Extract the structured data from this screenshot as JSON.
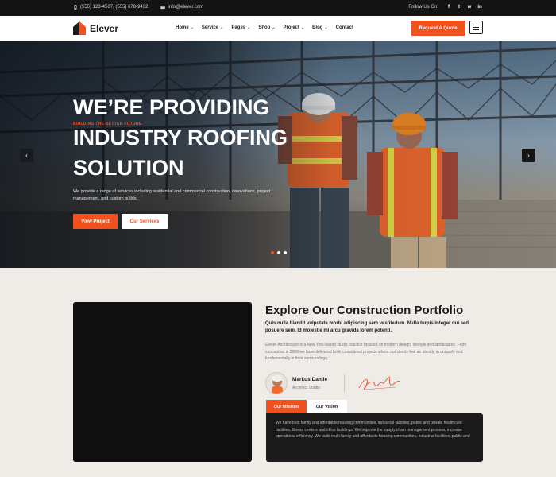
{
  "topbar": {
    "phone": "(555) 123-4567, (555) 678-9432",
    "email": "info@elever.com",
    "follow_label": "Follow Us On:",
    "social": [
      {
        "icon": "facebook-icon",
        "glyph": "f"
      },
      {
        "icon": "twitter-icon",
        "glyph": "t"
      },
      {
        "icon": "whatsapp-icon",
        "glyph": "w"
      },
      {
        "icon": "linkedin-icon",
        "glyph": "in"
      }
    ]
  },
  "header": {
    "brand": "Elever",
    "nav": [
      {
        "label": "Home",
        "has_dropdown": true
      },
      {
        "label": "Service",
        "has_dropdown": true
      },
      {
        "label": "Pages",
        "has_dropdown": true
      },
      {
        "label": "Shop",
        "has_dropdown": true
      },
      {
        "label": "Project",
        "has_dropdown": true
      },
      {
        "label": "Blog",
        "has_dropdown": true
      },
      {
        "label": "Contact",
        "has_dropdown": false
      }
    ],
    "cta_label": "Request A Quote",
    "menu_icon": "hamburger-icon"
  },
  "hero": {
    "kicker": "BUILDING THE BETTER FUTURE",
    "title_lines": [
      "WE’RE PROVIDING",
      "INDUSTRY ROOFING",
      "SOLUTION"
    ],
    "description": "We provide a range of services including residential and commercial construction, renovations, project management, and custom builds.",
    "primary_button": "View Project",
    "secondary_button": "Our Services",
    "prev_icon": "arrow-left-icon",
    "next_icon": "arrow-right-icon",
    "slide_count": 3,
    "active_slide": 1
  },
  "portfolio": {
    "title": "Explore Our Construction Portfolio",
    "subtitle": "Quis nulla blandit vulputate morbi adipiscing sem vestibulum. Nulla turpis integer dui sed posuere sem. Id molestie mi arcu gravida lorem potenti.",
    "body": "Elever Architecture is a New York-based studio practice focused on modern design, lifestyle and landscapes. From conception in 2006 we have delivered bold, considered projects where our clients feel an identity in uniquely and fundamentally in their surroundings.",
    "author_name": "Markus Danile",
    "author_role": "Architect Studio",
    "tabs": [
      {
        "label": "Our Mission",
        "active": true
      },
      {
        "label": "Our Vision",
        "active": false
      }
    ],
    "tab_content": "We have built family and affordable housing communities, industrial facilities, public and private healthcare facilities, fitness centers and office buildings. We improve the supply chain management process, increase operational efficiency. We build multi-family and affordable housing communities, industrial facilities, public and"
  },
  "colors": {
    "accent": "#f0511f",
    "dark": "#141414",
    "section_bg": "#efebe6"
  }
}
